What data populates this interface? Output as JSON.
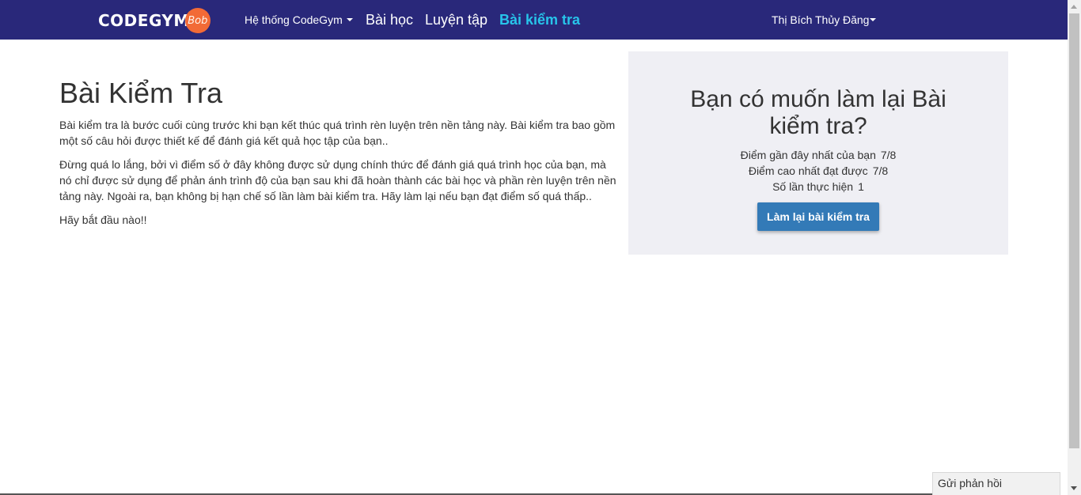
{
  "navbar": {
    "logo_text": "CODEGYM",
    "logo_badge": "Bob",
    "system_menu": "Hệ thống CodeGym",
    "lessons": "Bài học",
    "practice": "Luyện tập",
    "test": "Bài kiểm tra",
    "user_name": "Thị Bích Thủy Đăng",
    "background_color": "#29287a",
    "active_color": "#27c4ea"
  },
  "main": {
    "title": "Bài Kiểm Tra",
    "paragraphs": [
      "Bài kiểm tra là bước cuối cùng trước khi bạn kết thúc quá trình rèn luyện trên nền tảng này. Bài kiểm tra bao gồm một số câu hỏi được thiết kế để đánh giá kết quả học tập của bạn..",
      "Đừng quá lo lắng, bởi vì điểm số ở đây không được sử dụng chính thức để đánh giá quá trình học của bạn, mà nó chỉ được sử dụng để phản ánh trình độ của bạn sau khi đã hoàn thành các bài học và phần rèn luyện trên nền tảng này. Ngoài ra, bạn không bị hạn chế số lần làm bài kiểm tra. Hãy làm lại nếu bạn đạt điểm số quá thấp..",
      "Hãy bắt đầu nào!!"
    ]
  },
  "panel": {
    "title": "Bạn có muốn làm lại Bài kiểm tra?",
    "stats": [
      {
        "label": "Điểm gần đây nhất của bạn",
        "value": "7/8"
      },
      {
        "label": "Điểm cao nhất đạt được",
        "value": "7/8"
      },
      {
        "label": "Số lần thực hiện",
        "value": "1"
      }
    ],
    "retry_button": "Làm lại bài kiểm tra",
    "button_color": "#337ab7"
  },
  "feedback": {
    "label": "Gửi phản hồi"
  }
}
